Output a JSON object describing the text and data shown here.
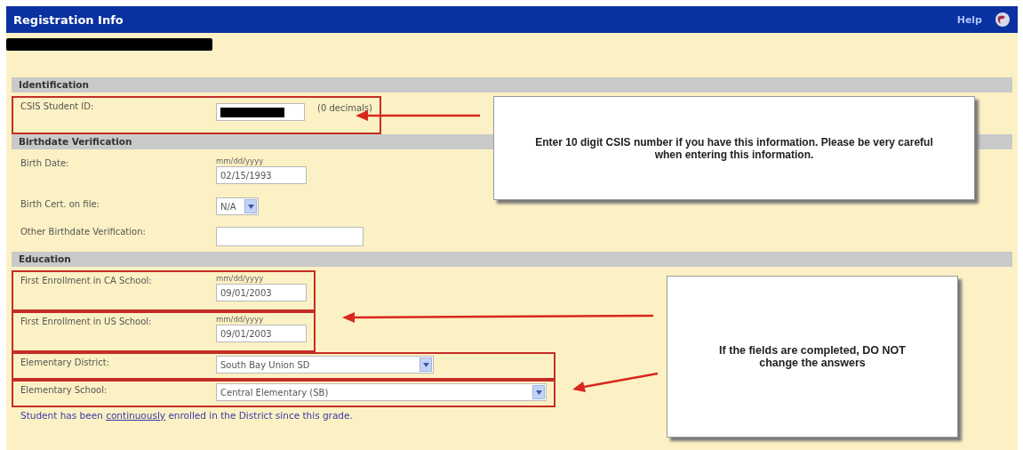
{
  "window": {
    "title": "Registration Info",
    "help": "Help"
  },
  "sections": [
    {
      "title": "Identification",
      "rows": [
        {
          "kind": "redacted",
          "label": "CSIS Student ID:",
          "note": "(0 decimals)",
          "highlighted": true
        }
      ]
    },
    {
      "title": "Birthdate Verification",
      "rows": [
        {
          "kind": "date",
          "label": "Birth Date:",
          "format_hint": "mm/dd/yyyy",
          "value": "02/15/1993",
          "highlighted": false
        },
        {
          "kind": "select",
          "label": "Birth Cert. on file:",
          "value": "N/A",
          "highlighted": false
        },
        {
          "kind": "text",
          "label": "Other Birthdate Verification:",
          "highlighted": false
        }
      ]
    },
    {
      "title": "Education",
      "rows": [
        {
          "kind": "date",
          "label": "First Enrollment in CA School:",
          "format_hint": "mm/dd/yyyy",
          "value": "09/01/2003",
          "highlighted": true
        },
        {
          "kind": "date",
          "label": "First Enrollment in US School:",
          "format_hint": "mm/dd/yyyy",
          "value": "09/01/2003",
          "highlighted": true
        },
        {
          "kind": "select",
          "label": "Elementary District:",
          "value": "South Bay Union SD",
          "highlighted": true
        },
        {
          "kind": "select",
          "label": "Elementary School:",
          "value": "Central Elementary (SB)",
          "highlighted": true
        }
      ]
    }
  ],
  "footnote": {
    "before": "Student has been ",
    "link": "continuously",
    "after": " enrolled in the District since this grade."
  },
  "callouts": [
    {
      "text": "Enter 10 digit CSIS number if you have this information. Please be very careful when entering this information."
    },
    {
      "text": "If the fields are completed, DO NOT change the answers"
    }
  ]
}
